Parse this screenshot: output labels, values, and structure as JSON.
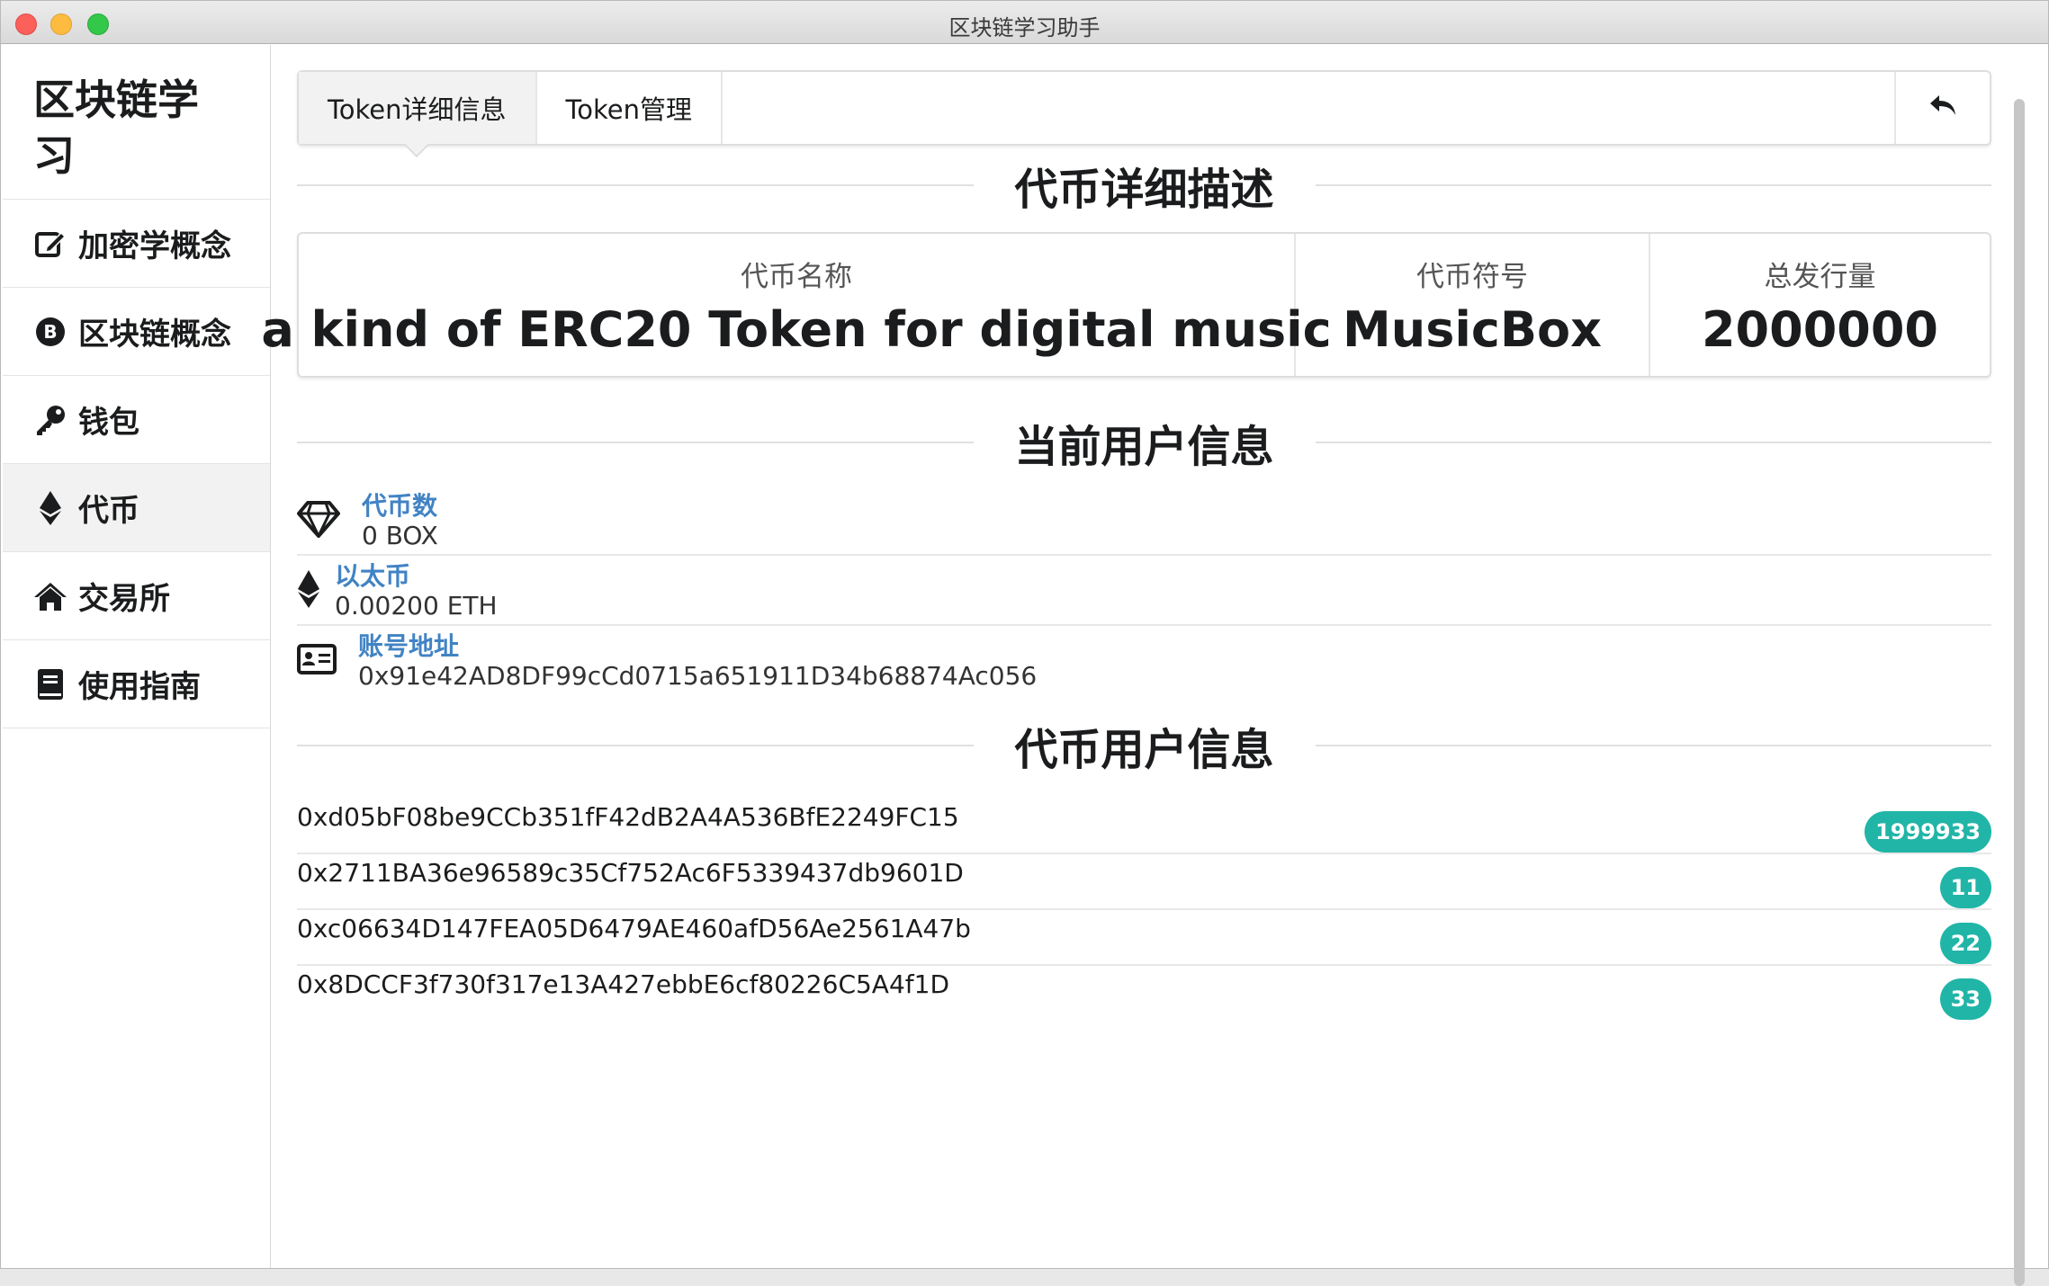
{
  "window": {
    "title": "区块链学习助手"
  },
  "sidebar": {
    "brand": "区块链学习",
    "items": [
      {
        "label": "加密学概念",
        "icon": "edit-icon"
      },
      {
        "label": "区块链概念",
        "icon": "bitcoin-icon"
      },
      {
        "label": "钱包",
        "icon": "key-icon"
      },
      {
        "label": "代币",
        "icon": "ethereum-icon",
        "active": true
      },
      {
        "label": "交易所",
        "icon": "home-icon"
      },
      {
        "label": "使用指南",
        "icon": "book-icon"
      }
    ]
  },
  "tabs": [
    {
      "label": "Token详细信息",
      "active": true
    },
    {
      "label": "Token管理"
    }
  ],
  "back_button_icon": "reply-icon",
  "sections": {
    "token_detail": "代币详细描述",
    "current_user": "当前用户信息",
    "token_users": "代币用户信息"
  },
  "token": {
    "name_label": "代币名称",
    "name": "a kind of ERC20 Token for digital music",
    "symbol_label": "代币符号",
    "symbol": "MusicBox",
    "supply_label": "总发行量",
    "supply": "2000000"
  },
  "current_user": {
    "token_count": {
      "label": "代币数",
      "value": "0 BOX",
      "icon": "diamond-icon"
    },
    "ether": {
      "label": "以太币",
      "value": "0.00200 ETH",
      "icon": "ethereum-icon"
    },
    "address": {
      "label": "账号地址",
      "value": "0x91e42AD8DF99cCd0715a651911D34b68874Ac056",
      "icon": "id-card-icon"
    }
  },
  "holders": [
    {
      "address": "0xd05bF08be9CCb351fF42dB2A4A536BfE2249FC15",
      "balance": "1999933"
    },
    {
      "address": "0x2711BA36e96589c35Cf752Ac6F5339437db9601D",
      "balance": "11"
    },
    {
      "address": "0xc06634D147FEA05D6479AE460afD56Ae2561A47b",
      "balance": "22"
    },
    {
      "address": "0x8DCCF3f730f317e13A427ebbE6cf80226C5A4f1D",
      "balance": "33"
    }
  ],
  "colors": {
    "badge": "#21b5a7",
    "link": "#4183c4",
    "active_bg": "#f2f2f2"
  }
}
